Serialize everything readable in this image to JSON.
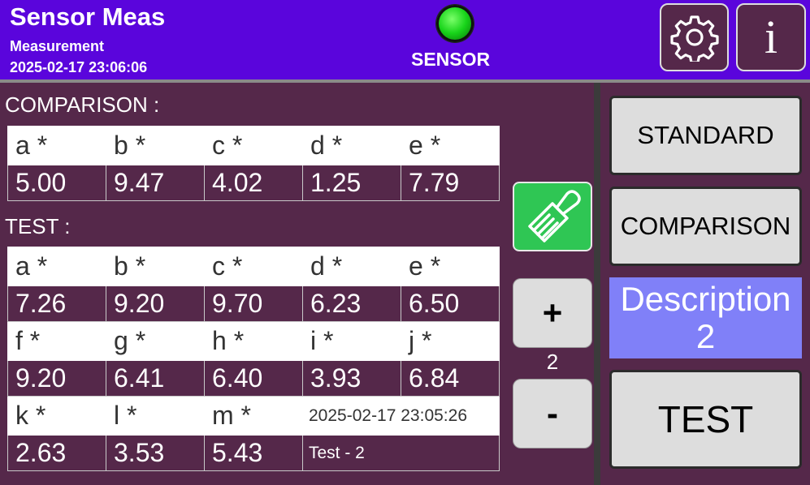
{
  "header": {
    "title": "Sensor Meas",
    "subtitle": "Measurement",
    "datetime": "2025-02-17 23:06:06",
    "sensor_label": "SENSOR",
    "led_color": "#18d41a",
    "settings_icon": "gear-icon",
    "info_label": "i"
  },
  "comparison": {
    "label": "COMPARISON :",
    "headers": [
      "a *",
      "b *",
      "c *",
      "d *",
      "e *"
    ],
    "values": [
      "5.00",
      "9.47",
      "4.02",
      "1.25",
      "7.79"
    ]
  },
  "test": {
    "label": "TEST :",
    "rows": [
      {
        "headers": [
          "a *",
          "b *",
          "c *",
          "d *",
          "e *"
        ],
        "values": [
          "7.26",
          "9.20",
          "9.70",
          "6.23",
          "6.50"
        ]
      },
      {
        "headers": [
          "f *",
          "g *",
          "h *",
          "i *",
          "j *"
        ],
        "values": [
          "9.20",
          "6.41",
          "6.40",
          "3.93",
          "6.84"
        ]
      },
      {
        "headers": [
          "k *",
          "l *",
          "m *",
          "2025-02-17 23:05:26"
        ],
        "values": [
          "2.63",
          "3.53",
          "5.43",
          "Test - 2"
        ]
      }
    ]
  },
  "controls": {
    "clear_icon": "brush-icon",
    "plus_label": "+",
    "minus_label": "-",
    "counter": "2"
  },
  "side": {
    "standard_label": "STANDARD",
    "comparison_label": "COMPARISON",
    "description_line1": "Description",
    "description_line2": "2",
    "test_label": "TEST"
  },
  "colors": {
    "header_bg": "#5a05dc",
    "body_bg": "#55284a",
    "description_bg": "#8080f8",
    "brush_button_bg": "#2fc654"
  }
}
